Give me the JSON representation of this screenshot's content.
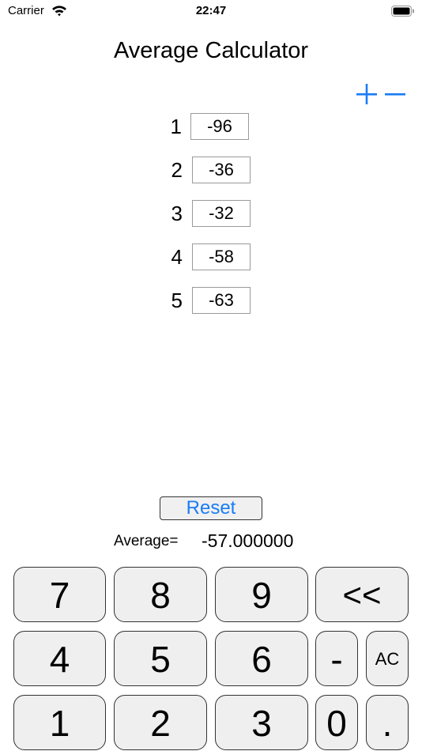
{
  "status_bar": {
    "carrier": "Carrier",
    "time": "22:47"
  },
  "title": "Average Calculator",
  "entries": [
    {
      "index": "1",
      "value": "-96"
    },
    {
      "index": "2",
      "value": "-36"
    },
    {
      "index": "3",
      "value": "-32"
    },
    {
      "index": "4",
      "value": "-58"
    },
    {
      "index": "5",
      "value": "-63"
    }
  ],
  "reset_label": "Reset",
  "average": {
    "label": "Average=",
    "value": "-57.000000"
  },
  "keypad": {
    "k7": "7",
    "k8": "8",
    "k9": "9",
    "back": "<<",
    "k4": "4",
    "k5": "5",
    "k6": "6",
    "minus": "-",
    "ac": "AC",
    "k1": "1",
    "k2": "2",
    "k3": "3",
    "k0": "0",
    "dot": "."
  },
  "colors": {
    "accent": "#1a7cf5"
  }
}
